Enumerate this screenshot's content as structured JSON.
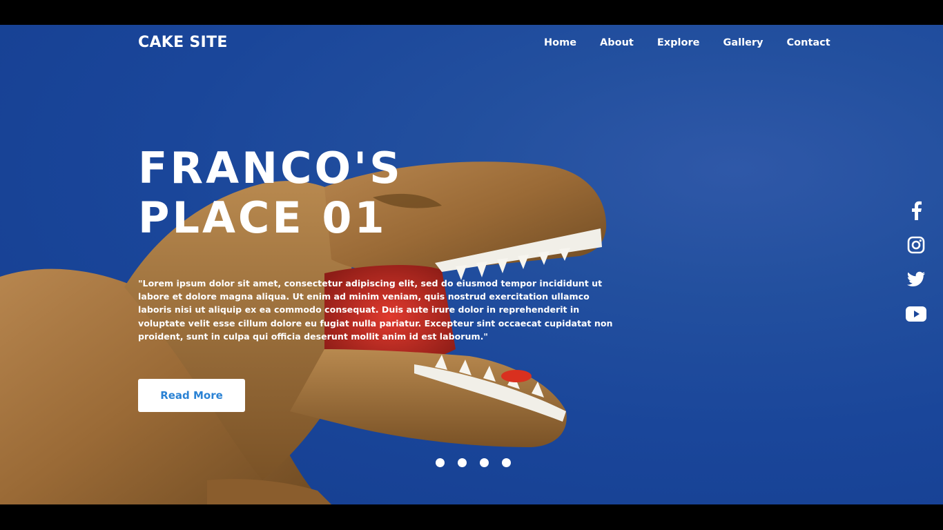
{
  "header": {
    "logo": "CAKE SITE",
    "nav": [
      "Home",
      "About",
      "Explore",
      "Gallery",
      "Contact"
    ]
  },
  "hero": {
    "title_line1": "FRANCO'S",
    "title_line2": "PLACE 01",
    "text": "\"Lorem ipsum dolor sit amet, consectetur adipiscing elit, sed do eiusmod tempor incididunt ut labore et dolore magna aliqua. Ut enim ad minim veniam, quis nostrud exercitation ullamco laboris nisi ut aliquip ex ea commodo consequat. Duis aute irure dolor in reprehenderit in voluptate velit esse cillum dolore eu fugiat nulla pariatur. Excepteur sint occaecat cupidatat non proident, sunt in culpa qui officia deserunt mollit anim id est laborum.\"",
    "button_label": "Read More"
  },
  "slider": {
    "dot_count": 4
  },
  "social": {
    "icons": [
      "facebook-icon",
      "instagram-icon",
      "twitter-icon",
      "youtube-icon"
    ]
  },
  "colors": {
    "background": "#1a469a",
    "button_text": "#2a82d4",
    "text": "#ffffff"
  }
}
